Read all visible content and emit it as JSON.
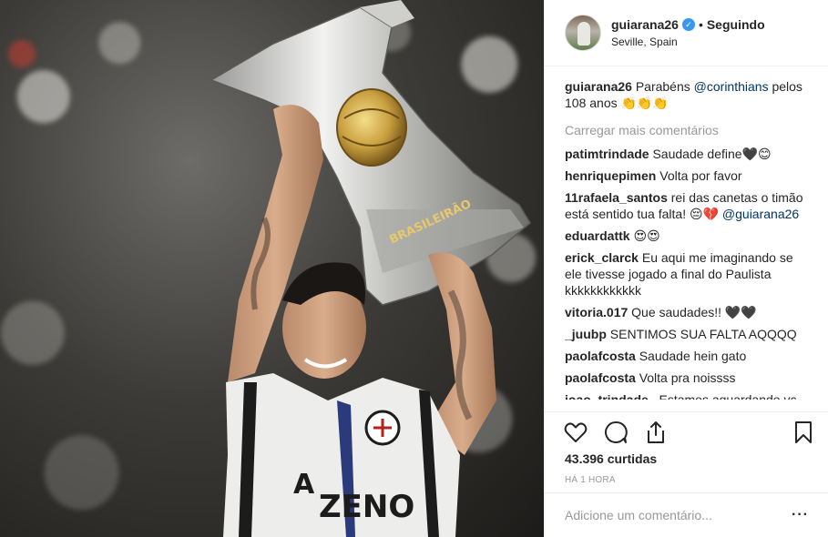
{
  "post": {
    "username": "guiarana26",
    "verified_badge": "✓",
    "separator": "•",
    "follow_status": "Seguindo",
    "location": "Seville, Spain",
    "caption": {
      "username": "guiarana26",
      "text_before": "Parabéns ",
      "mention": "@corinthians",
      "text_after": " pelos 108 anos 👏👏👏"
    },
    "load_more": "Carregar mais comentários",
    "comments": [
      {
        "user": "patimtrindade",
        "text": "Saudade define🖤😊"
      },
      {
        "user": "henriquepimen",
        "text": "Volta por favor"
      },
      {
        "user": "11rafaela_santos",
        "text": "rei das canetas o timão está sentido tua falta! 😔💔 ",
        "mention": "@guiarana26"
      },
      {
        "user": "eduardattk",
        "text": "😍😍"
      },
      {
        "user": "erick_clarck",
        "text": "Eu aqui me imaginando se ele tivesse jogado a final do Paulista kkkkkkkkkkkk"
      },
      {
        "user": "vitoria.017",
        "text": "Que saudades!! 🖤🖤"
      },
      {
        "user": "_juubp",
        "text": "SENTIMOS SUA FALTA AQQQQ"
      },
      {
        "user": "paolafcosta",
        "text": "Saudade hein gato"
      },
      {
        "user": "paolafcosta",
        "text": "Volta pra noissss"
      },
      {
        "user": "joao_trindade_",
        "text": "Estamos aguardando vc de volta"
      }
    ],
    "likes": "43.396 curtidas",
    "timestamp": "HÁ 1 HORA",
    "add_comment_placeholder": "Adicione um comentário...",
    "more_options": "···"
  },
  "photo": {
    "trophy_text": "BRASILEIRÃO",
    "shirt_sponsor": "ZENO",
    "shirt_sponsor_prefix": "A"
  },
  "icons": [
    "heart-icon",
    "comment-icon",
    "share-icon",
    "bookmark-icon"
  ],
  "colors": {
    "mention": "#003569",
    "verified": "#3897f0",
    "muted": "#999999",
    "text": "#262626"
  }
}
